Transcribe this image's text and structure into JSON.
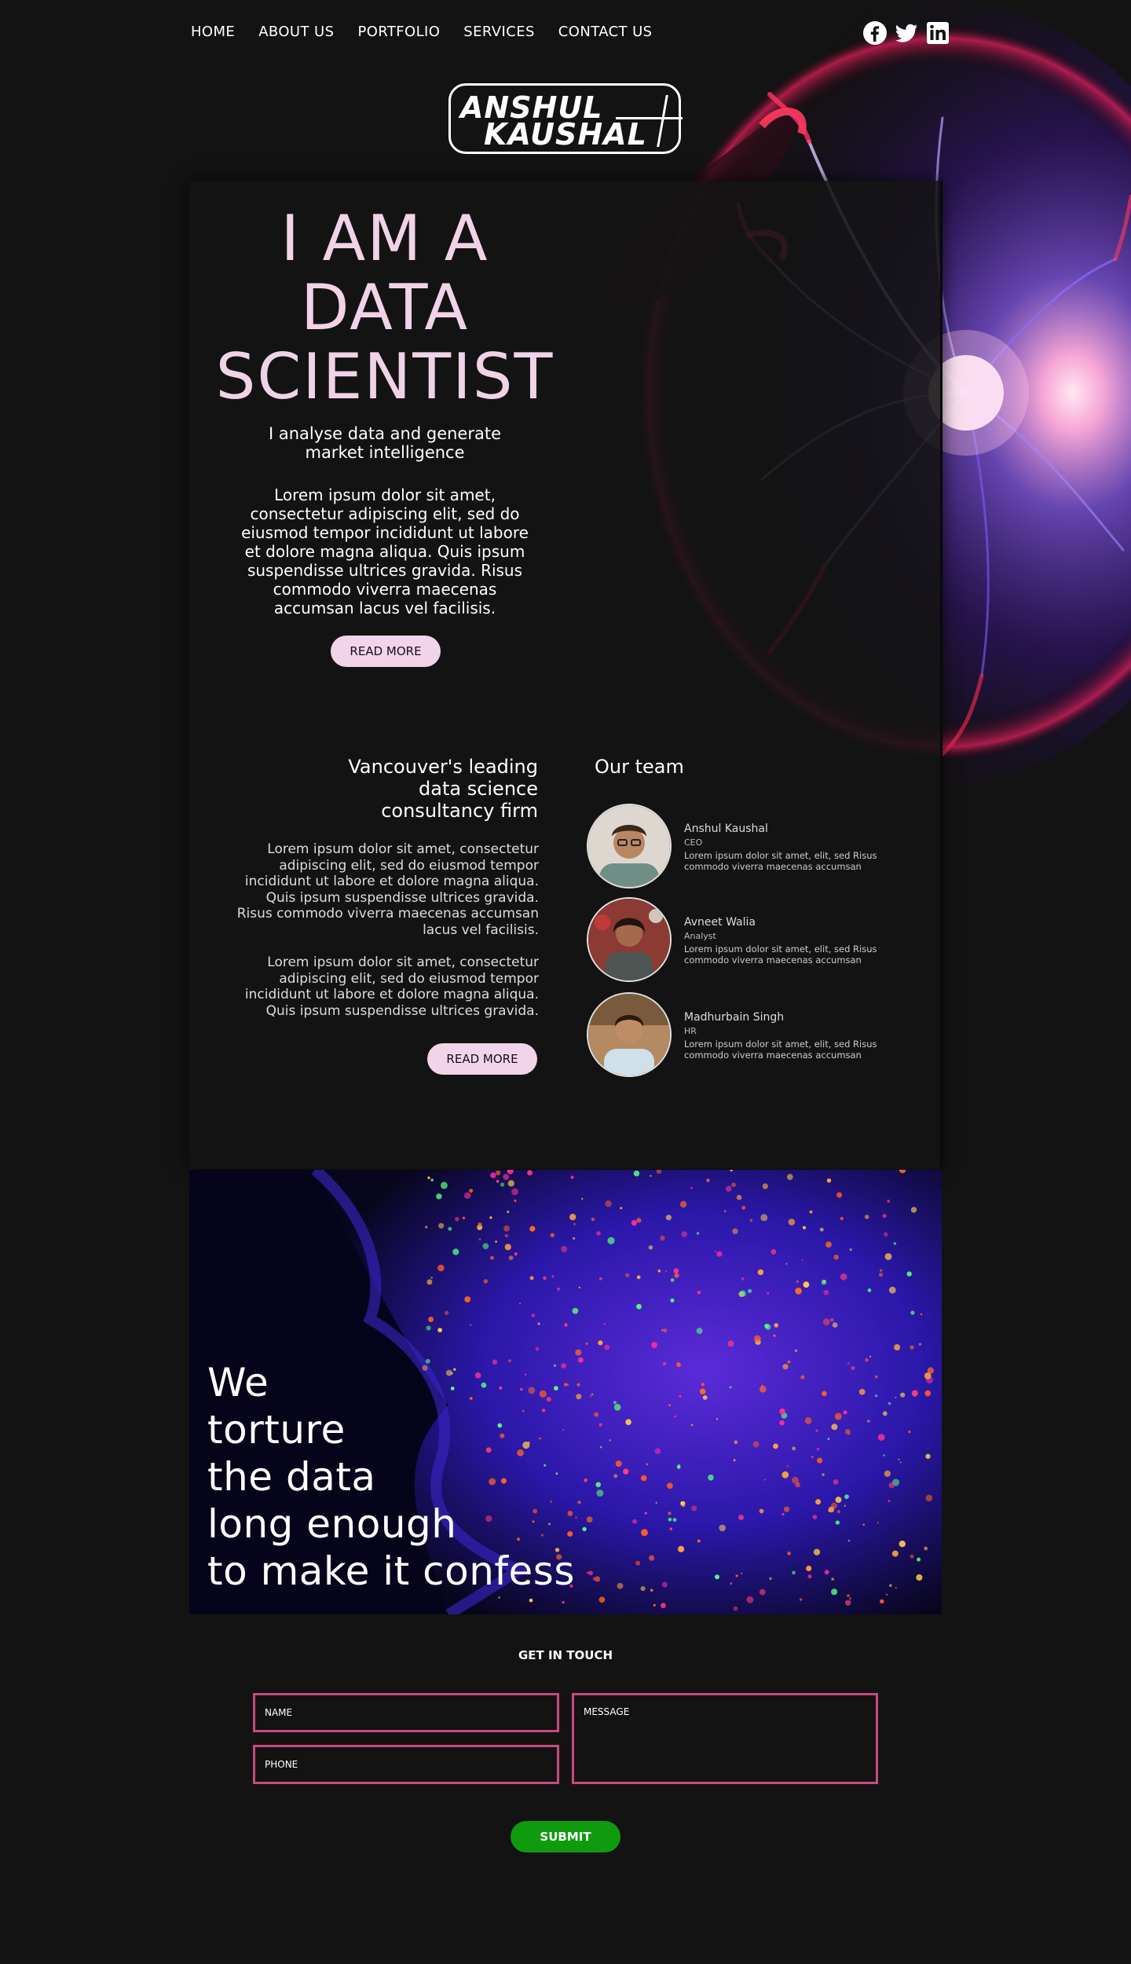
{
  "nav": {
    "items": [
      "HOME",
      "ABOUT US",
      "PORTFOLIO",
      "SERVICES",
      "CONTACT US"
    ]
  },
  "social": {
    "icons": [
      "facebook-icon",
      "twitter-icon",
      "linkedin-icon"
    ]
  },
  "logo": {
    "line1": "ANSHUL",
    "line2": "KAUSHAL"
  },
  "hero": {
    "title_lines": [
      "I AM A",
      "DATA",
      "SCIENTIST"
    ],
    "subtitle": "I analyse data and generate market intelligence",
    "body": "Lorem ipsum dolor sit amet, consectetur adipiscing elit, sed do eiusmod tempor incididunt ut labore et dolore magna aliqua. Quis ipsum suspendisse ultrices gravida. Risus commodo viverra maecenas accumsan lacus vel facilisis.",
    "button": "READ MORE"
  },
  "about": {
    "title": "Vancouver's leading data science consultancy firm",
    "para1": "Lorem ipsum dolor sit amet, consectetur adipiscing elit, sed do eiusmod tempor incididunt ut labore et dolore magna aliqua. Quis ipsum suspendisse ultrices gravida. Risus commodo viverra maecenas accumsan lacus vel facilisis.",
    "para2": "Lorem ipsum dolor sit amet, consectetur adipiscing elit, sed do eiusmod tempor incididunt ut labore et dolore magna aliqua. Quis ipsum suspendisse ultrices gravida.",
    "button": "READ MORE"
  },
  "team": {
    "title": "Our team",
    "members": [
      {
        "name": "Anshul Kaushal",
        "role": "CEO",
        "desc": "Lorem ipsum dolor sit amet, elit, sed Risus commodo viverra maecenas accumsan"
      },
      {
        "name": "Avneet Walia",
        "role": "Analyst",
        "desc": "Lorem ipsum dolor sit amet, elit, sed Risus commodo viverra maecenas accumsan"
      },
      {
        "name": "Madhurbain Singh",
        "role": "HR",
        "desc": "Lorem ipsum dolor sit amet, elit, sed Risus commodo viverra maecenas accumsan"
      }
    ]
  },
  "quote": {
    "lines": [
      "We",
      "torture",
      "the data",
      "long enough",
      "to make it confess"
    ]
  },
  "contact": {
    "heading": "GET IN TOUCH",
    "name_placeholder": "NAME",
    "phone_placeholder": "PHONE",
    "message_placeholder": "MESSAGE",
    "submit": "SUBMIT"
  },
  "colors": {
    "background": "#131313",
    "accent_pink": "#f2d4ea",
    "field_border": "#c9487f",
    "submit_green": "#0e9b0e"
  }
}
